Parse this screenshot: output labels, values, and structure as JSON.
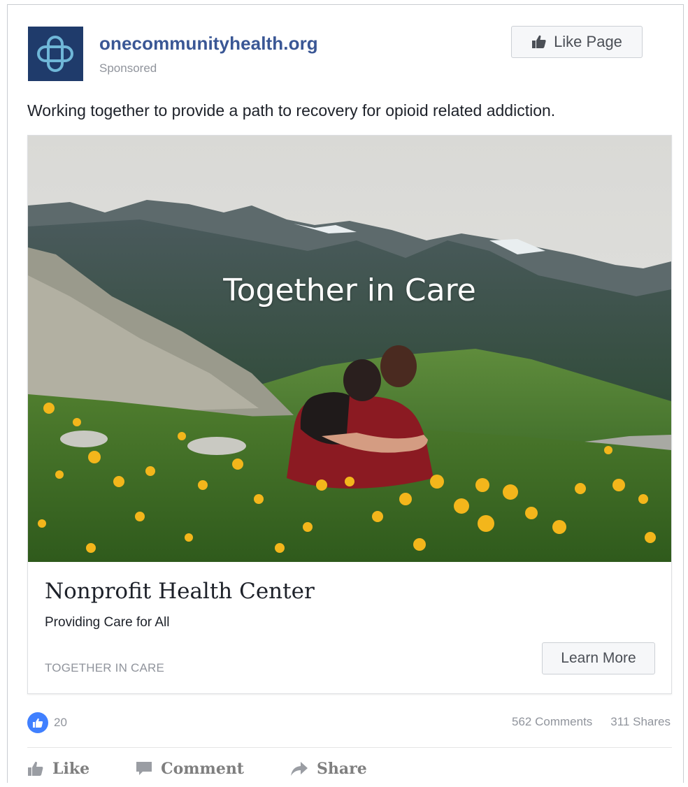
{
  "header": {
    "page_name": "onecommunityhealth.org",
    "sponsored_label": "Sponsored",
    "like_page_label": "Like Page",
    "logo_icon": "medical-cross-logo",
    "logo_color": "#1f3b6b"
  },
  "post": {
    "text": "Working together to provide a path to recovery for opioid related addiction."
  },
  "ad": {
    "image_overlay_text": "Together in Care",
    "title": "Nonprofit Health Center",
    "description": "Providing Care for All",
    "domain_caption": "TOGETHER IN CARE",
    "cta_label": "Learn More"
  },
  "engagement": {
    "like_count": "20",
    "comments": "562 Comments",
    "shares": "311 Shares"
  },
  "actions": {
    "like": "Like",
    "comment": "Comment",
    "share": "Share"
  },
  "colors": {
    "link_blue": "#3a5795",
    "reaction_blue": "#4080ff",
    "muted": "#90949c"
  }
}
